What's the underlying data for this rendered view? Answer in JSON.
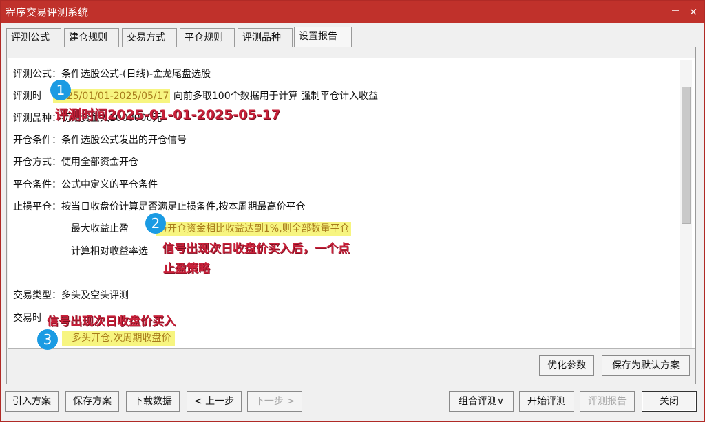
{
  "window": {
    "title": "程序交易评测系统",
    "controls": [
      "×"
    ]
  },
  "tabs": [
    {
      "label": "评测公式"
    },
    {
      "label": "建仓规则"
    },
    {
      "label": "交易方式"
    },
    {
      "label": "平仓规则"
    },
    {
      "label": "评测品种"
    },
    {
      "label": "设置报告"
    }
  ],
  "report": {
    "lines": {
      "formula": "评测公式：条件选股公式-(日线)-金龙尾盘选股",
      "time_label": "评测时",
      "time_range": "2025/01/01-2025/05/17",
      "time_rest": "向前多取100个数据用于计算 强制平仓计入收益",
      "variety": "评测品种：初始资金入1000000元",
      "open_cond": "开仓条件：条件选股公式发出的开仓信号",
      "open_method": "开仓方式：使用全部资金开仓",
      "close_cond": "平仓条件：公式中定义的平仓条件",
      "stop_loss": "止损平仓：按当日收盘价计算是否满足止损条件,按本周期最高价平仓",
      "max_profit_label": "最大收益止盈",
      "max_profit_value": "与开仓资金相比收益达到1%,则全部数量平仓",
      "relative_rate": "计算相对收益率选",
      "trade_type": "交易类型：多头及空头评测",
      "trade_time_label": "交易时",
      "trade_time_value": "多头开仓,次周期收盘价"
    },
    "annotations": {
      "badge1": "1",
      "badge2": "2",
      "badge3": "3",
      "note1": "评测时间2025-01-01-2025-05-17",
      "note2_line1": "信号出现次日收盘价买入后，一个点",
      "note2_line2": "止盈策略",
      "note3": "信号出现次日收盘价买入"
    }
  },
  "panel_buttons": {
    "optimize": "优化参数",
    "save_default": "保存为默认方案"
  },
  "bottom_buttons": {
    "import": "引入方案",
    "save": "保存方案",
    "download": "下载数据",
    "prev": "< 上一步",
    "next": "下一步 >",
    "combo": "组合评测∨",
    "start": "开始评测",
    "report": "评测报告",
    "close": "关闭"
  },
  "colors": {
    "titlebar": "#c0312b",
    "highlight": "#f7f580",
    "annotation": "#c8213a",
    "badge": "#1b9be3"
  }
}
